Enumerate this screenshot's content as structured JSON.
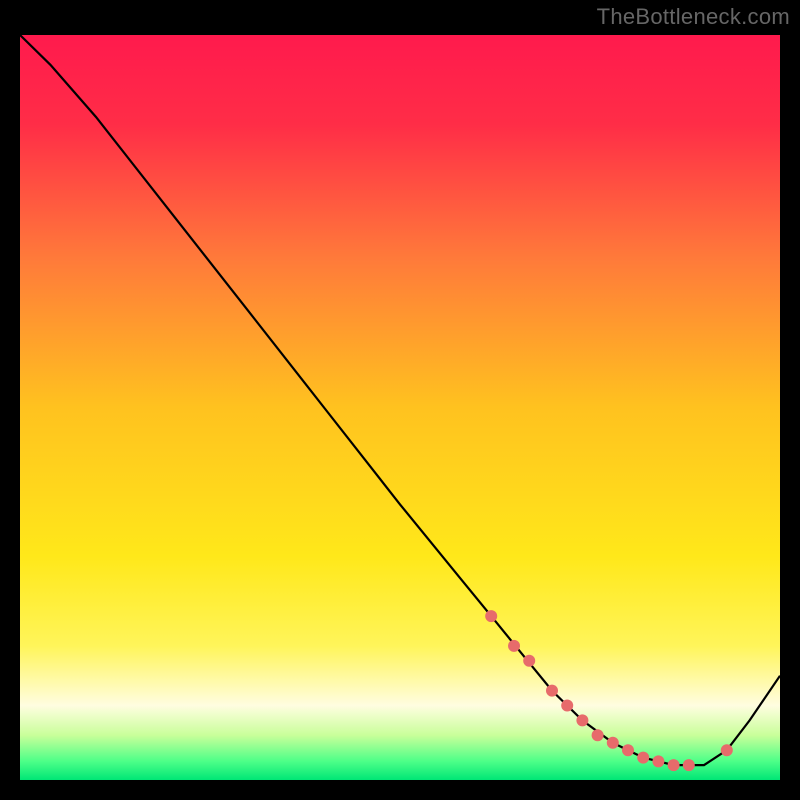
{
  "attribution": "TheBottleneck.com",
  "chart_data": {
    "type": "line",
    "title": "",
    "xlabel": "",
    "ylabel": "",
    "xlim": [
      0,
      100
    ],
    "ylim": [
      0,
      100
    ],
    "background_gradient": {
      "stops": [
        {
          "offset": 0.0,
          "color": "#ff1a4d"
        },
        {
          "offset": 0.12,
          "color": "#ff2d47"
        },
        {
          "offset": 0.3,
          "color": "#ff7a3a"
        },
        {
          "offset": 0.5,
          "color": "#ffc21f"
        },
        {
          "offset": 0.7,
          "color": "#ffe81a"
        },
        {
          "offset": 0.82,
          "color": "#fff55a"
        },
        {
          "offset": 0.9,
          "color": "#fffde0"
        },
        {
          "offset": 0.94,
          "color": "#c9ff9a"
        },
        {
          "offset": 0.975,
          "color": "#4dff88"
        },
        {
          "offset": 1.0,
          "color": "#00e676"
        }
      ]
    },
    "series": [
      {
        "name": "bottleneck-curve",
        "x": [
          0,
          4,
          10,
          20,
          30,
          40,
          50,
          58,
          62,
          66,
          70,
          74,
          78,
          82,
          86,
          90,
          93,
          96,
          100
        ],
        "y": [
          100,
          96,
          89,
          76,
          63,
          50,
          37,
          27,
          22,
          17,
          12,
          8,
          5,
          3,
          2,
          2,
          4,
          8,
          14
        ]
      }
    ],
    "marker_points": {
      "name": "highlight-dots",
      "color": "#e76b6b",
      "x": [
        62,
        65,
        67,
        70,
        72,
        74,
        76,
        78,
        80,
        82,
        84,
        86,
        88,
        93
      ],
      "y": [
        22,
        18,
        16,
        12,
        10,
        8,
        6,
        5,
        4,
        3,
        2.5,
        2,
        2,
        4
      ]
    }
  }
}
